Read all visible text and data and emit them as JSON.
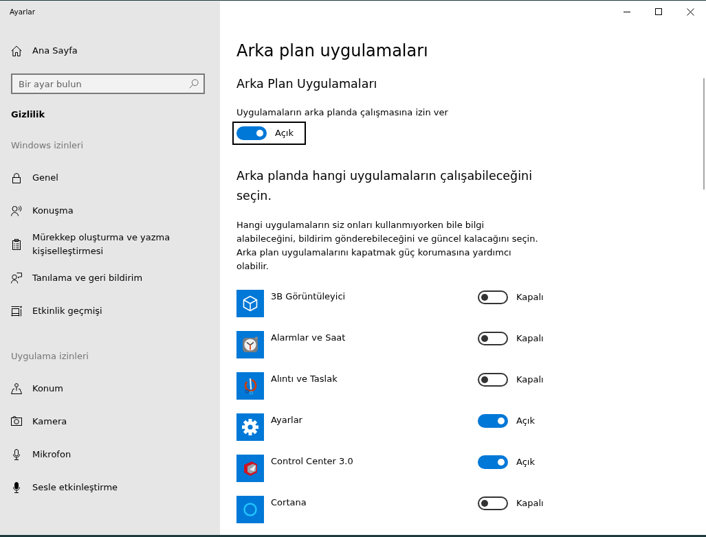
{
  "window": {
    "title": "Ayarlar"
  },
  "sidebar": {
    "home": {
      "label": "Ana Sayfa"
    },
    "search": {
      "placeholder": "Bir ayar bulun"
    },
    "category": "Gizlilik",
    "sections": [
      {
        "heading": "Windows izinleri",
        "items": [
          {
            "label": "Genel",
            "selected": false
          },
          {
            "label": "Konuşma",
            "selected": false
          },
          {
            "label": "Mürekkep oluşturma ve yazma kişiselleştirmesi",
            "selected": false
          },
          {
            "label": "Tanılama ve geri bildirim",
            "selected": false
          },
          {
            "label": "Etkinlik geçmişi",
            "selected": false
          }
        ]
      },
      {
        "heading": "Uygulama izinleri",
        "items": [
          {
            "label": "Konum",
            "selected": false
          },
          {
            "label": "Kamera",
            "selected": false
          },
          {
            "label": "Mikrofon",
            "selected": false
          },
          {
            "label": "Sesle etkinleştirme",
            "selected": false
          }
        ]
      }
    ]
  },
  "main": {
    "title": "Arka plan uygulamaları",
    "section_title": "Arka Plan Uygulamaları",
    "master_toggle": {
      "label": "Uygulamaların arka planda çalışmasına izin ver",
      "on": true,
      "state_text": "Açık",
      "focused": true
    },
    "apps_heading": "Arka planda hangi uygulamaların çalışabileceğini seçin.",
    "description": "Hangi uygulamaların siz onları kullanmıyorken bile bilgi alabileceğini, bildirim gönderebileceğini ve güncel kalacağını seçin. Arka plan uygulamalarını kapatmak güç korumasına yardımcı olabilir.",
    "apps": [
      {
        "name": "3B Görüntüleyici",
        "on": false,
        "state_text": "Kapalı"
      },
      {
        "name": "Alarmlar ve Saat",
        "on": false,
        "state_text": "Kapalı"
      },
      {
        "name": "Alıntı ve Taslak",
        "on": false,
        "state_text": "Kapalı"
      },
      {
        "name": "Ayarlar",
        "on": true,
        "state_text": "Açık"
      },
      {
        "name": "Control Center 3.0",
        "on": true,
        "state_text": "Açık"
      },
      {
        "name": "Cortana",
        "on": false,
        "state_text": "Kapalı"
      }
    ]
  }
}
